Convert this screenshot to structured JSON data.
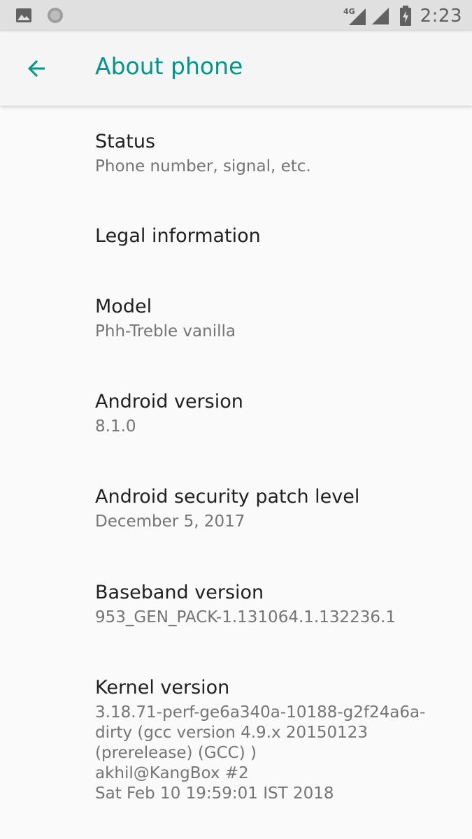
{
  "status_bar": {
    "time": "2:23",
    "network_label": "4G",
    "icons": [
      "image-notification-icon",
      "circle-notification-icon",
      "4g-icon",
      "signal-icon",
      "battery-charging-icon"
    ]
  },
  "app_bar": {
    "title": "About phone",
    "back_icon": "arrow-back-icon",
    "accent_color": "#009688"
  },
  "items": [
    {
      "title": "Status",
      "summary": "Phone number, signal, etc."
    },
    {
      "title": "Legal information",
      "summary": ""
    },
    {
      "title": "Model",
      "summary": "Phh-Treble vanilla"
    },
    {
      "title": "Android version",
      "summary": "8.1.0"
    },
    {
      "title": "Android security patch level",
      "summary": "December 5, 2017"
    },
    {
      "title": "Baseband version",
      "summary": "953_GEN_PACK-1.131064.1.132236.1"
    },
    {
      "title": "Kernel version",
      "summary": "3.18.71-perf-ge6a340a-10188-g2f24a6a-\ndirty (gcc version 4.9.x 20150123\n(prerelease) (GCC) )\nakhil@KangBox #2\nSat Feb 10 19:59:01 IST 2018"
    }
  ]
}
